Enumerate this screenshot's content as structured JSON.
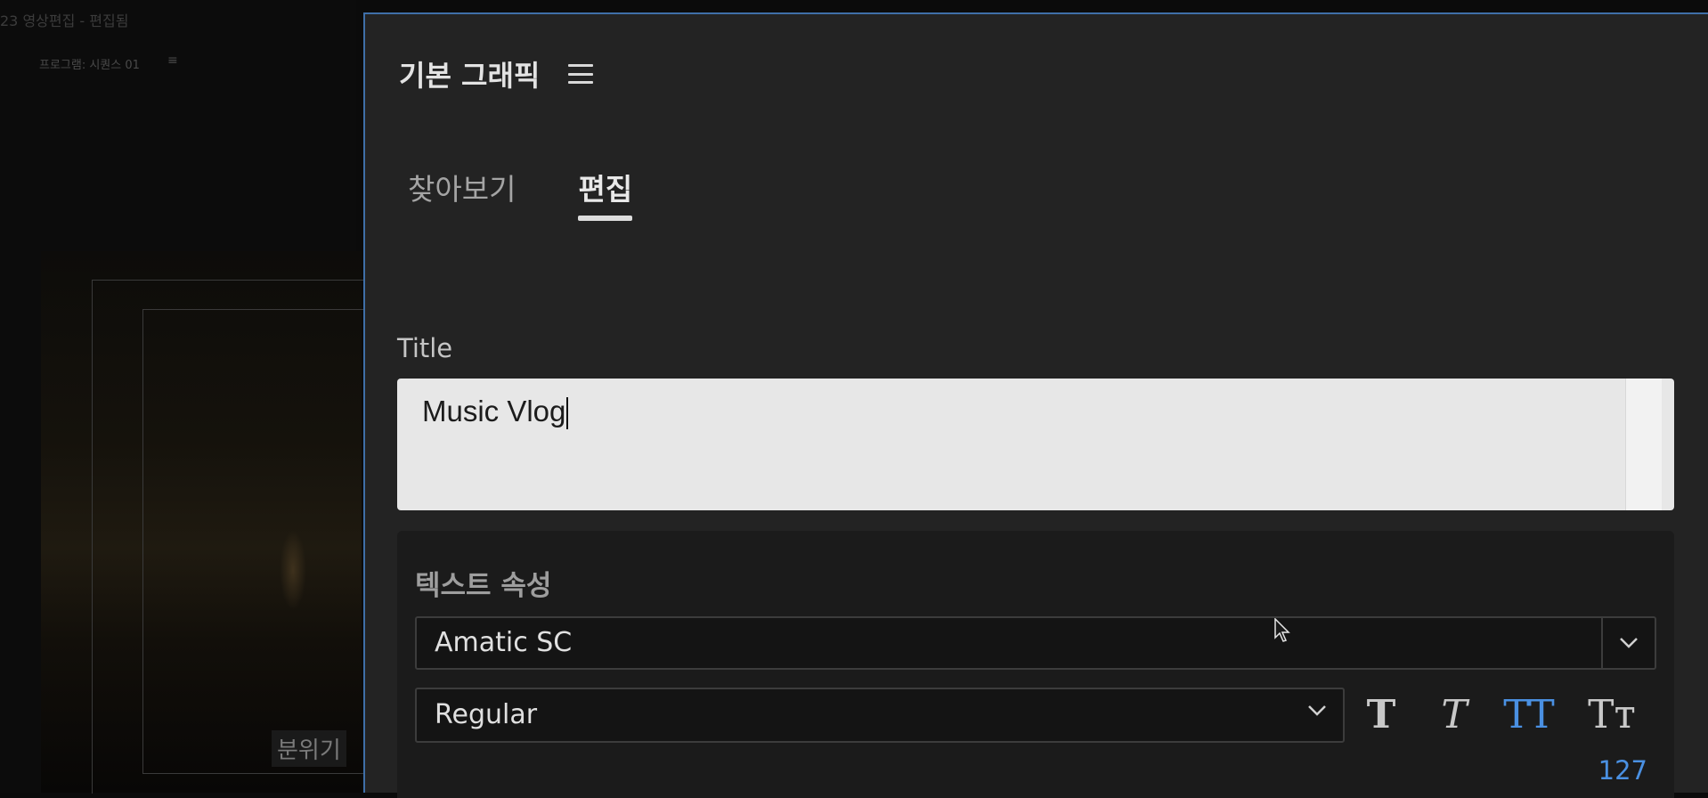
{
  "background": {
    "window_title": "23 영상편집 - 편집됨",
    "monitor_label": "프로그램: 시퀀스 01",
    "monitor_menu_icon": "menu-icon",
    "caption_chip": "분위기"
  },
  "panel": {
    "title": "기본 그래픽",
    "menu_icon": "hamburger-menu-icon",
    "tabs": [
      {
        "label": "찾아보기",
        "active": false
      },
      {
        "label": "편집",
        "active": true
      }
    ],
    "field_label": "Title",
    "title_value": "Music Vlog",
    "text_properties": {
      "section_title": "텍스트 속성",
      "font_family": "Amatic SC",
      "font_style": "Regular",
      "format_buttons": [
        {
          "name": "faux-bold",
          "glyph": "T",
          "active": false
        },
        {
          "name": "faux-italic",
          "glyph": "T",
          "active": false
        },
        {
          "name": "all-caps",
          "glyph": "TT",
          "active": true
        },
        {
          "name": "small-caps",
          "glyph": "Tт",
          "active": false
        }
      ],
      "value_readout": "127"
    }
  },
  "colors": {
    "accent": "#4a90e2",
    "panel_bg": "#232323",
    "panel_border": "#3f6fa8",
    "input_bg": "#e7e7e7"
  }
}
